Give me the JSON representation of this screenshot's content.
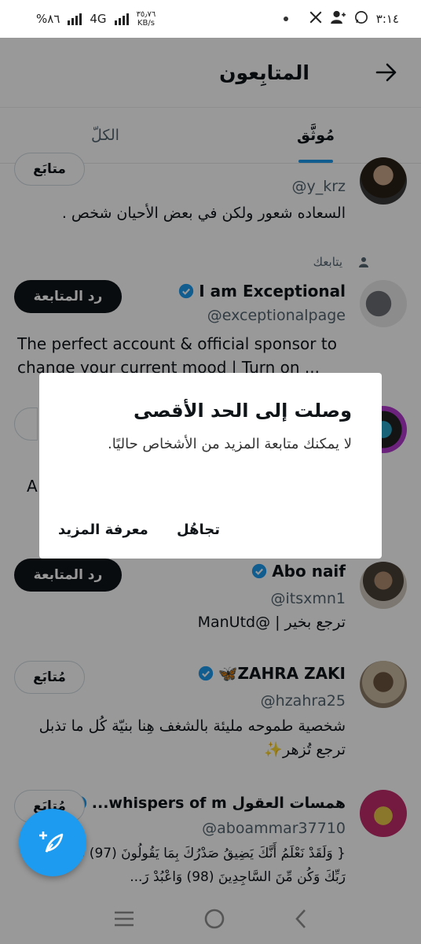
{
  "status_bar": {
    "time": "٣:١٤",
    "battery": "%٨٦",
    "network": "4G",
    "speed": "٣٥٫٧٦",
    "speed_unit": "KB/s"
  },
  "header": {
    "title": "المتابِعون"
  },
  "tabs": [
    {
      "label": "مُوثَّق"
    },
    {
      "label": "الكلّ"
    }
  ],
  "rows": [
    {
      "handle": "@y_krz",
      "bio": "السعاده شعور ولكن في بعض الأحيان شخص .",
      "button": "متابَع"
    },
    {
      "follows_you": "يتابعك",
      "name": "I am Exceptional",
      "handle": "@exceptionalpage",
      "bio": "The perfect account & official sponsor to change your current mood | Turn on ...",
      "button": "رد المتابعة"
    },
    {
      "name": "Abo naif",
      "handle": "@itsxmn1",
      "bio": "ترجع بخير | @ManUtd",
      "button": "رد المتابعة"
    },
    {
      "name": "ZAHRA ZAKI🦋",
      "handle": "@hzahra25",
      "bio": "شخصية طموحه مليئة بالشغف هِنا بنيّة كُل ما تذبل ترجع تُزهر✨",
      "button": "مُتابَع"
    },
    {
      "name": "همسات العقول whispers of m...",
      "handle": "@aboammar37710",
      "bio": "{ وَلَقَدْ نَعْلَمُ أَنَّكَ يَضِيقُ صَدْرُكَ بِمَا يَقُولُونَ (97) فَسَبِّحْ بِحَمْدِ رَبِّكَ وَكُن مِّنَ السَّاجِدِينَ (98) وَاعْبُدْ رَ...",
      "button": "مُتابَع"
    }
  ],
  "partial_row_text": "A",
  "dialog": {
    "title": "وصلت إلى الحد الأقصى",
    "message": "لا يمكنك متابعة المزيد من الأشخاص حاليًا.",
    "ignore": "تجاهُل",
    "learn_more": "معرفة المزيد"
  },
  "icons": {
    "back": "arrow-right-icon",
    "verified": "verified-badge-icon",
    "compose": "compose-feather-icon"
  },
  "colors": {
    "accent": "#1d9bf0",
    "dark_button": "#0f1419"
  }
}
